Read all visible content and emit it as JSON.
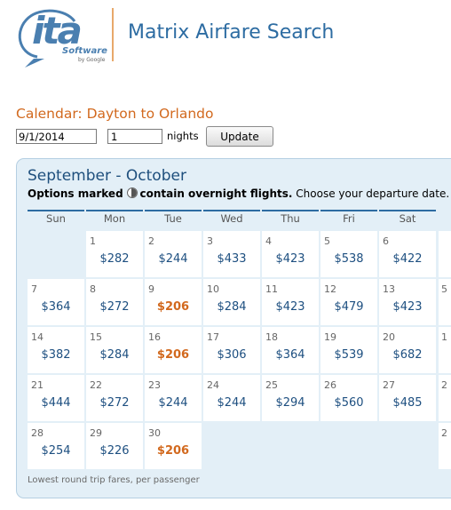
{
  "header": {
    "logo_word": "ita",
    "logo_sub": "Software",
    "logo_by": "by Google",
    "app_title": "Matrix Airfare Search"
  },
  "search": {
    "calendar_title": "Calendar: Dayton to Orlando",
    "date_value": "9/1/2014",
    "nights_value": "1",
    "nights_label": "nights",
    "update_label": "Update"
  },
  "calendar": {
    "month_title": "September - October",
    "options_bold_1": "Options marked",
    "options_bold_2": "contain overnight flights.",
    "options_rest": "Choose your departure date.",
    "weekdays": [
      "Sun",
      "Mon",
      "Tue",
      "Wed",
      "Thu",
      "Fri",
      "Sat"
    ],
    "weeks": [
      [
        {
          "day": "",
          "price": ""
        },
        {
          "day": "1",
          "price": "$282"
        },
        {
          "day": "2",
          "price": "$244"
        },
        {
          "day": "3",
          "price": "$433"
        },
        {
          "day": "4",
          "price": "$423"
        },
        {
          "day": "5",
          "price": "$538"
        },
        {
          "day": "6",
          "price": "$422"
        }
      ],
      [
        {
          "day": "7",
          "price": "$364"
        },
        {
          "day": "8",
          "price": "$272"
        },
        {
          "day": "9",
          "price": "$206"
        },
        {
          "day": "10",
          "price": "$284"
        },
        {
          "day": "11",
          "price": "$423"
        },
        {
          "day": "12",
          "price": "$479"
        },
        {
          "day": "13",
          "price": "$423"
        }
      ],
      [
        {
          "day": "14",
          "price": "$382"
        },
        {
          "day": "15",
          "price": "$284"
        },
        {
          "day": "16",
          "price": "$206"
        },
        {
          "day": "17",
          "price": "$306"
        },
        {
          "day": "18",
          "price": "$364"
        },
        {
          "day": "19",
          "price": "$539"
        },
        {
          "day": "20",
          "price": "$682"
        }
      ],
      [
        {
          "day": "21",
          "price": "$444"
        },
        {
          "day": "22",
          "price": "$272"
        },
        {
          "day": "23",
          "price": "$244"
        },
        {
          "day": "24",
          "price": "$244"
        },
        {
          "day": "25",
          "price": "$294"
        },
        {
          "day": "26",
          "price": "$560"
        },
        {
          "day": "27",
          "price": "$485"
        }
      ],
      [
        {
          "day": "28",
          "price": "$254"
        },
        {
          "day": "29",
          "price": "$226"
        },
        {
          "day": "30",
          "price": "$206"
        },
        {
          "day": "",
          "price": ""
        },
        {
          "day": "",
          "price": ""
        },
        {
          "day": "",
          "price": ""
        },
        {
          "day": "",
          "price": ""
        }
      ]
    ],
    "partial_next_days": [
      "",
      "5",
      "1",
      "2",
      "2"
    ],
    "lowest_price": "$206",
    "footnote": "Lowest round trip fares, per passenger"
  },
  "colors": {
    "accent_orange": "#d2691e",
    "link_blue": "#1d4f80",
    "panel_bg": "#e3eff7"
  }
}
